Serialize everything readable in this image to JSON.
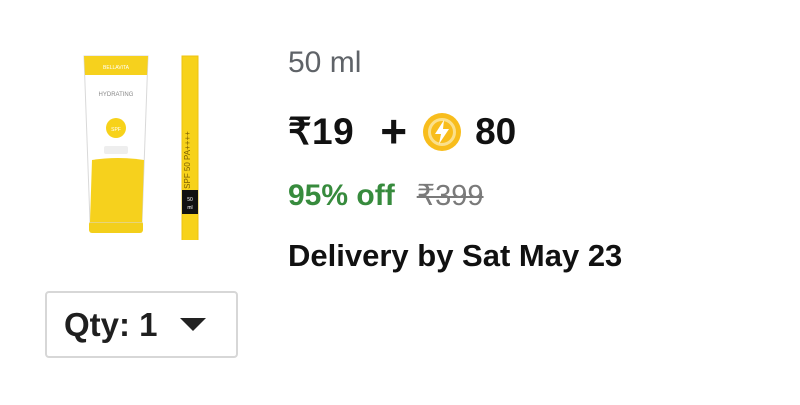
{
  "product": {
    "image_icon": "sunscreen-product-image",
    "image_text": {
      "brand": "BELLAVITA",
      "name": "HYDRATING",
      "spf": "SPF 50 PA++++",
      "size": "50 ml"
    },
    "size_label": "50 ml",
    "price": "₹19",
    "plus": "+",
    "coin_icon": "lightning-coin-icon",
    "coins": "80",
    "discount": "95% off",
    "original_price": "₹399",
    "delivery": "Delivery by Sat May 23"
  },
  "quantity": {
    "label": "Qty: 1",
    "icon": "dropdown-caret-icon"
  },
  "colors": {
    "discount_green": "#378b3d",
    "coin_yellow": "#f8bd1c",
    "tube_yellow": "#f7d21a"
  }
}
